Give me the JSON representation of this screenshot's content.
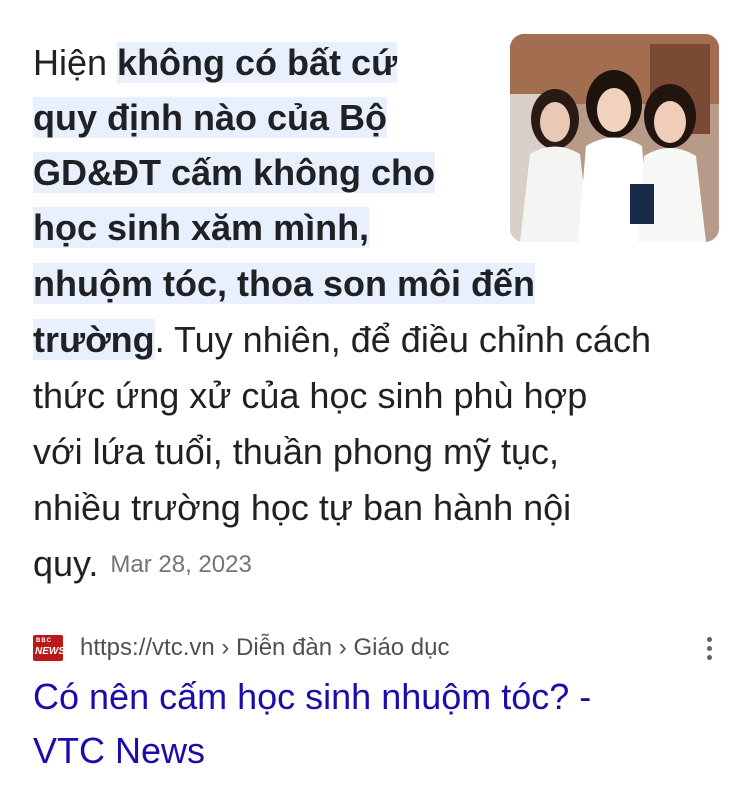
{
  "snippet": {
    "line1_plain": "Hiện ",
    "line1_highlight": "không có bất cứ",
    "line2_highlight": "quy định nào của Bộ",
    "line3_highlight": "GD&ĐT cấm không cho",
    "line4_highlight": "học sinh xăm mình,",
    "line5_highlight": "nhuộm tóc, thoa son môi đến",
    "line6_highlight": "trường",
    "line6_plain": ". Tuy nhiên, để điều chỉnh cách",
    "line7": "thức ứng xử của học sinh phù hợp",
    "line8": "với lứa tuổi, thuần phong mỹ tục,",
    "line9": "nhiều trường học tự ban hành nội",
    "line10": "quy.",
    "date": "Mar 28, 2023"
  },
  "thumbnail": {
    "icon": "students-photo"
  },
  "source": {
    "favicon_top": "BBC",
    "favicon_bottom": "NEWS",
    "url_path": "https://vtc.vn › Diễn đàn › Giáo dục"
  },
  "result": {
    "title_line1": "Có nên cấm học sinh nhuộm tóc? -",
    "title_line2": "VTC News"
  },
  "colors": {
    "highlight": "#e8f0fe",
    "link": "#1a0dab",
    "favicon": "#bb1919"
  }
}
